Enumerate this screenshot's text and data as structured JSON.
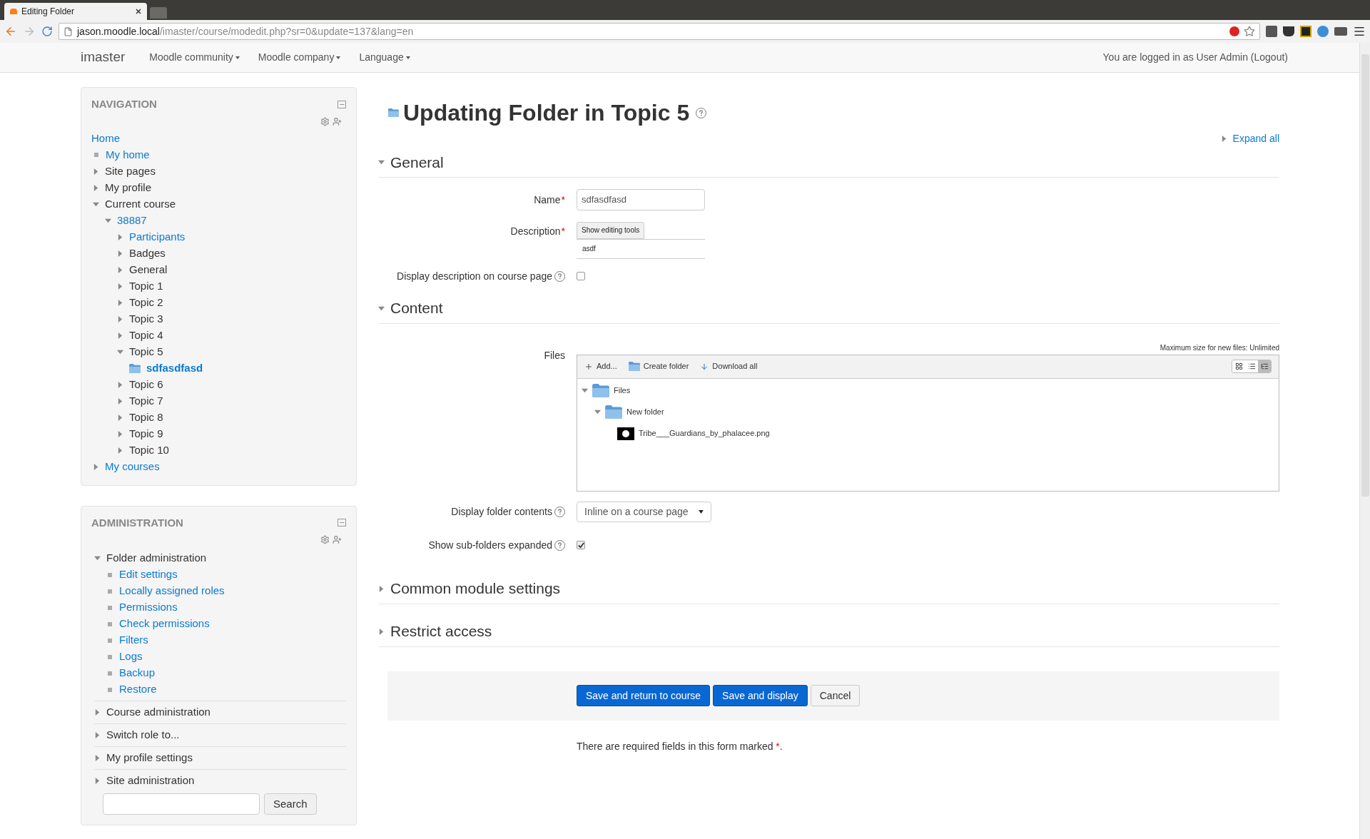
{
  "browser": {
    "tab_title": "Editing Folder",
    "url_host": "jason.moodle.local",
    "url_path": "/imaster/course/modedit.php?sr=0&update=137&lang=en"
  },
  "navbar": {
    "brand": "imaster",
    "menus": [
      "Moodle community",
      "Moodle company",
      "Language"
    ],
    "login_text": "You are logged in as User Admin (Logout)"
  },
  "navigation": {
    "title": "NAVIGATION",
    "items": [
      {
        "label": "Home",
        "link": true,
        "kind": "root",
        "children": [
          {
            "label": "My home",
            "link": true,
            "kind": "leaf"
          },
          {
            "label": "Site pages",
            "link": false,
            "kind": "branch",
            "expanded": false
          },
          {
            "label": "My profile",
            "link": false,
            "kind": "branch",
            "expanded": false
          },
          {
            "label": "Current course",
            "link": false,
            "kind": "branch",
            "expanded": true,
            "children": [
              {
                "label": "38887",
                "link": true,
                "kind": "branch",
                "expanded": true,
                "children": [
                  {
                    "label": "Participants",
                    "link": true,
                    "kind": "branch",
                    "expanded": false
                  },
                  {
                    "label": "Badges",
                    "link": false,
                    "kind": "branch",
                    "expanded": false
                  },
                  {
                    "label": "General",
                    "link": false,
                    "kind": "branch",
                    "expanded": false
                  },
                  {
                    "label": "Topic 1",
                    "link": false,
                    "kind": "branch",
                    "expanded": false
                  },
                  {
                    "label": "Topic 2",
                    "link": false,
                    "kind": "branch",
                    "expanded": false
                  },
                  {
                    "label": "Topic 3",
                    "link": false,
                    "kind": "branch",
                    "expanded": false
                  },
                  {
                    "label": "Topic 4",
                    "link": false,
                    "kind": "branch",
                    "expanded": false
                  },
                  {
                    "label": "Topic 5",
                    "link": false,
                    "kind": "branch",
                    "expanded": true,
                    "children": [
                      {
                        "label": "sdfasdfasd",
                        "link": true,
                        "kind": "folder"
                      }
                    ]
                  },
                  {
                    "label": "Topic 6",
                    "link": false,
                    "kind": "branch",
                    "expanded": false
                  },
                  {
                    "label": "Topic 7",
                    "link": false,
                    "kind": "branch",
                    "expanded": false
                  },
                  {
                    "label": "Topic 8",
                    "link": false,
                    "kind": "branch",
                    "expanded": false
                  },
                  {
                    "label": "Topic 9",
                    "link": false,
                    "kind": "branch",
                    "expanded": false
                  },
                  {
                    "label": "Topic 10",
                    "link": false,
                    "kind": "branch",
                    "expanded": false
                  }
                ]
              }
            ]
          },
          {
            "label": "My courses",
            "link": true,
            "kind": "branch",
            "expanded": false
          }
        ]
      }
    ]
  },
  "administration": {
    "title": "ADMINISTRATION",
    "items": [
      {
        "label": "Folder administration",
        "link": false,
        "kind": "branch",
        "expanded": true,
        "children": [
          {
            "label": "Edit settings",
            "link": true,
            "kind": "leaf"
          },
          {
            "label": "Locally assigned roles",
            "link": true,
            "kind": "leaf"
          },
          {
            "label": "Permissions",
            "link": true,
            "kind": "leaf"
          },
          {
            "label": "Check permissions",
            "link": true,
            "kind": "leaf"
          },
          {
            "label": "Filters",
            "link": true,
            "kind": "leaf"
          },
          {
            "label": "Logs",
            "link": true,
            "kind": "leaf"
          },
          {
            "label": "Backup",
            "link": true,
            "kind": "leaf"
          },
          {
            "label": "Restore",
            "link": true,
            "kind": "leaf"
          }
        ]
      },
      {
        "label": "Course administration",
        "link": false,
        "kind": "branch",
        "expanded": false
      },
      {
        "label": "Switch role to...",
        "link": false,
        "kind": "branch",
        "expanded": false
      },
      {
        "label": "My profile settings",
        "link": false,
        "kind": "branch",
        "expanded": false
      },
      {
        "label": "Site administration",
        "link": false,
        "kind": "branch",
        "expanded": false
      }
    ],
    "search_button": "Search"
  },
  "page": {
    "heading": "Updating Folder in Topic 5",
    "expand_all": "Expand all",
    "required_mark": "*",
    "sections": [
      {
        "title": "General",
        "expanded": true,
        "fields": [
          {
            "kind": "text",
            "label": "Name",
            "required": true,
            "value": "sdfasdfasd"
          },
          {
            "kind": "editor",
            "label": "Description",
            "required": true,
            "toggle": "Show editing tools",
            "value": "asdf"
          },
          {
            "kind": "checkbox",
            "label": "Display description on course page",
            "help": true,
            "checked": false
          }
        ]
      },
      {
        "title": "Content",
        "expanded": true,
        "fields": [
          {
            "kind": "filemanager",
            "label": "Files",
            "max_size": "Maximum size for new files: Unlimited",
            "actions": [
              "Add...",
              "Create folder",
              "Download all"
            ],
            "view_modes": [
              {
                "kind": "icons",
                "selected": false
              },
              {
                "kind": "list",
                "selected": false
              },
              {
                "kind": "tree",
                "selected": true
              }
            ],
            "tree": [
              {
                "name": "Files",
                "kind": "folder",
                "expanded": true,
                "children": [
                  {
                    "name": "New folder",
                    "kind": "folder",
                    "expanded": true,
                    "children": [
                      {
                        "name": "Tribe___Guardians_by_phalacee.png",
                        "kind": "image"
                      }
                    ]
                  }
                ]
              }
            ]
          },
          {
            "kind": "select",
            "label": "Display folder contents",
            "help": true,
            "value": "Inline on a course page"
          },
          {
            "kind": "checkbox",
            "label": "Show sub-folders expanded",
            "help": true,
            "checked": true
          }
        ]
      },
      {
        "title": "Common module settings",
        "expanded": false
      },
      {
        "title": "Restrict access",
        "expanded": false
      }
    ],
    "buttons": [
      {
        "label": "Save and return to course",
        "kind": "primary"
      },
      {
        "label": "Save and display",
        "kind": "primary"
      },
      {
        "label": "Cancel",
        "kind": "default"
      }
    ],
    "footer": {
      "text": "There are required fields in this form marked",
      "mark": "*",
      "end": "."
    }
  }
}
